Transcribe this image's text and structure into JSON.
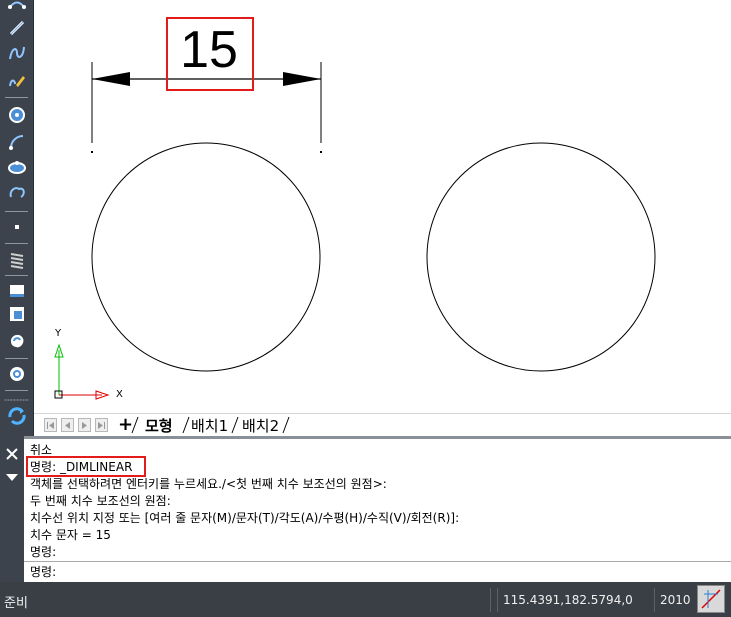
{
  "canvas": {
    "dimension_text": "15",
    "ucs_y_label": "Y",
    "ucs_x_label": "X"
  },
  "layout_tabs": {
    "add_label": "+",
    "tabs": [
      {
        "label": "모형",
        "active": true
      },
      {
        "label": "배치1",
        "active": false
      },
      {
        "label": "배치2",
        "active": false
      }
    ]
  },
  "command_history": {
    "lines": [
      "취소",
      "명령: _DIMLINEAR",
      "객체를 선택하려면 엔터키를 누르세요./<첫 번째 치수 보조선의 원점>:",
      "두 번째 치수 보조선의 원점:",
      "치수선 위치 지정 또는 [여러 줄 문자(M)/문자(T)/각도(A)/수평(H)/수직(V)/회전(R)]:",
      "치수 문자 = 15",
      "명령:"
    ],
    "prompt": "명령:"
  },
  "status_bar": {
    "state": "준비",
    "coordinates": "115.4391,182.5794,0",
    "version": "2010"
  },
  "colors": {
    "highlight": "#e31b1b",
    "toolbar_bg": "#3c434c",
    "status_bg": "#3a3f45",
    "ucs_y": "#00c000",
    "ucs_x": "#e00000"
  },
  "icons": [
    "polyline-icon",
    "line-icon",
    "spline-icon",
    "pencil-icon",
    "circle-icon",
    "arc-icon",
    "ellipse-icon",
    "revcloud-icon",
    "point-icon",
    "hatch-icon",
    "rectangle-icon",
    "region-icon",
    "blob-icon",
    "donut-icon",
    "sync-icon",
    "close-icon",
    "menu-down-icon",
    "snap-toggle-icon"
  ]
}
